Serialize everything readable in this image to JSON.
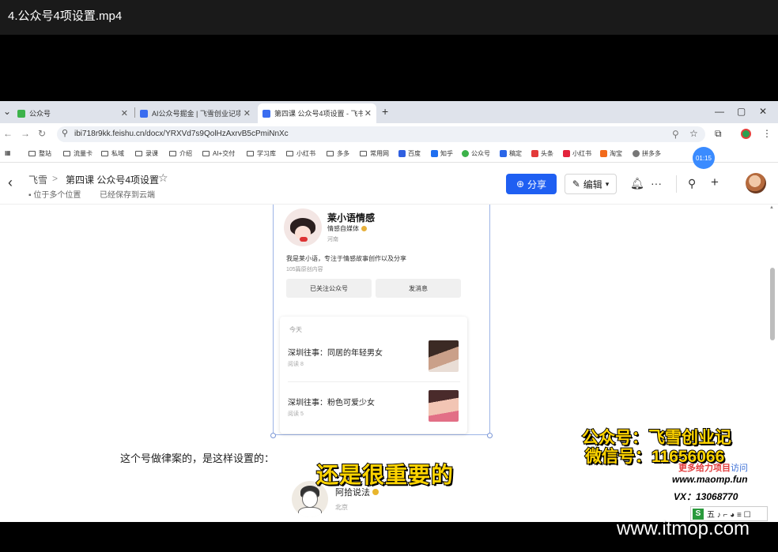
{
  "video": {
    "title": "4.公众号4项设置.mp4"
  },
  "browser": {
    "tabs": [
      {
        "label": "公众号",
        "active": false
      },
      {
        "label": "AI公众号掘金 | 飞雪创业记项目",
        "active": false
      },
      {
        "label": "第四课 公众号4项设置 - 飞书云",
        "active": true
      }
    ],
    "url": "ibi718r9kk.feishu.cn/docx/YRXVd7s9QolHzAxrvB5cPmiNnXc",
    "bookmarks": [
      "整站",
      "流量卡",
      "私域",
      "录课",
      "介绍",
      "AI+交付",
      "学习库",
      "小红书",
      "多多",
      "常用网",
      "百度",
      "知乎",
      "公众号",
      "稿定",
      "头条",
      "小红书",
      "淘宝",
      "拼多多"
    ]
  },
  "doc_header": {
    "breadcrumb_root": "飞雪",
    "breadcrumb_sep": ">",
    "doc_title": "第四课 公众号4项设置",
    "location": "位于多个位置",
    "save_status": "已经保存到云端",
    "share_label": "分享",
    "edit_label": "编辑",
    "timer": "01:15"
  },
  "embedded_profile": {
    "name": "莱小语情感",
    "type": "情感自媒体",
    "location": "河南",
    "description": "我是莱小语，专注于情感故事创作以及分享",
    "article_count": "105篇原创内容",
    "followed_button": "已关注公众号",
    "message_button": "发消息",
    "feed_day": "今天",
    "articles": [
      {
        "title": "深圳往事：同居的年轻男女",
        "reads": "阅读 8"
      },
      {
        "title": "深圳往事：粉色可爱少女",
        "reads": "阅读 5"
      }
    ]
  },
  "doc_body": {
    "paragraph": "这个号做律案的，是这样设置的：",
    "second_account": {
      "name": "阿拾说法",
      "location": "北京"
    }
  },
  "overlays": {
    "subtitle": "还是很重要的",
    "watermark_line1": "公众号：飞雪创业记",
    "watermark_line2": "微信号：11656066",
    "more_projects": "更多给力项目",
    "visit": "访问",
    "site_url": "www.maomp.fun",
    "vx": "VX：13068770",
    "ime": "五 ♪ ⌐ ◕ ≡ ☐",
    "brand": "www.itmop.com"
  },
  "colors": {
    "accent": "#1f5ff2",
    "subtitle": "#ffd400",
    "timer": "#3a8bff"
  }
}
